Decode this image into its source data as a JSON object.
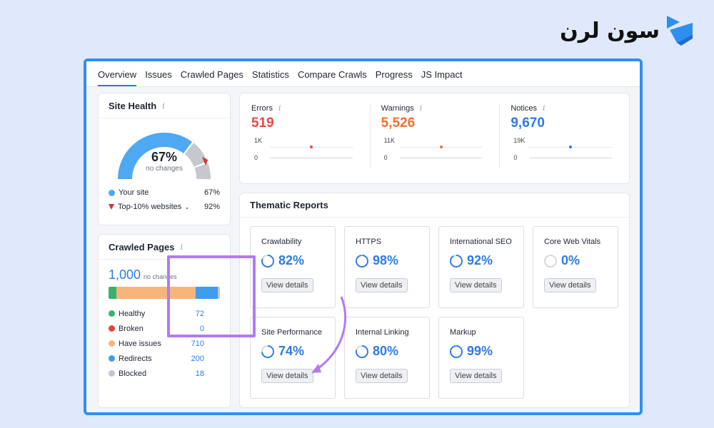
{
  "logo": {
    "text": "سون لرن"
  },
  "tabs": [
    "Overview",
    "Issues",
    "Crawled Pages",
    "Statistics",
    "Compare Crawls",
    "Progress",
    "JS Impact"
  ],
  "site_health": {
    "title": "Site Health",
    "percent": "67%",
    "sub": "no changes",
    "your_site_label": "Your site",
    "your_site_value": "67%",
    "top_label": "Top-10% websites",
    "top_value": "92%",
    "colors": {
      "your_site": "#4fa8f2",
      "top": "#d0353a"
    }
  },
  "crawled_pages": {
    "title": "Crawled Pages",
    "count": "1,000",
    "sub": "no changes",
    "items": [
      {
        "label": "Healthy",
        "value": "72",
        "color": "#37b36e",
        "share": 72
      },
      {
        "label": "Broken",
        "value": "0",
        "color": "#e0463c",
        "share": 0
      },
      {
        "label": "Have issues",
        "value": "710",
        "color": "#f7b57a",
        "share": 710
      },
      {
        "label": "Redirects",
        "value": "200",
        "color": "#3e9cf1",
        "share": 200
      },
      {
        "label": "Blocked",
        "value": "18",
        "color": "#c3c6cd",
        "share": 18
      }
    ]
  },
  "stats": [
    {
      "label": "Errors",
      "value": "519",
      "axis_top": "1K",
      "axis_bottom": "0",
      "color": "#e64a45"
    },
    {
      "label": "Warnings",
      "value": "5,526",
      "axis_top": "11K",
      "axis_bottom": "0",
      "color": "#f2702e"
    },
    {
      "label": "Notices",
      "value": "9,670",
      "axis_top": "19K",
      "axis_bottom": "0",
      "color": "#2c7be5"
    }
  ],
  "thematic": {
    "title": "Thematic Reports",
    "button_label": "View details",
    "reports": [
      {
        "name": "Crawlability",
        "pct": "82%",
        "fill": 82
      },
      {
        "name": "HTTPS",
        "pct": "98%",
        "fill": 98
      },
      {
        "name": "International SEO",
        "pct": "92%",
        "fill": 92
      },
      {
        "name": "Core Web Vitals",
        "pct": "0%",
        "fill": 0
      },
      {
        "name": "Site Performance",
        "pct": "74%",
        "fill": 74
      },
      {
        "name": "Internal Linking",
        "pct": "80%",
        "fill": 80
      },
      {
        "name": "Markup",
        "pct": "99%",
        "fill": 99
      }
    ]
  },
  "accent": "#2c7be5",
  "highlight_color": "#b27bef"
}
